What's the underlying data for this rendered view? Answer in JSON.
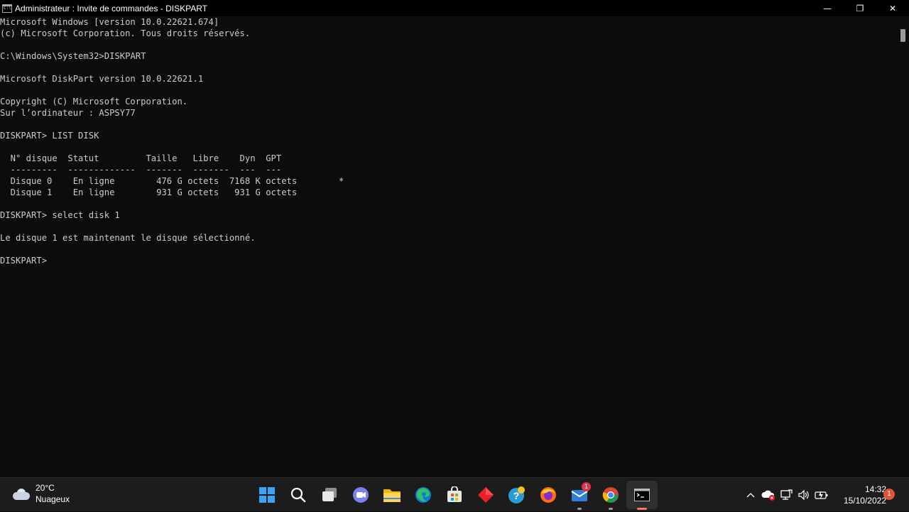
{
  "window": {
    "title": "Administrateur : Invite de commandes - DISKPART",
    "minimize_glyph": "—",
    "maximize_glyph": "❐",
    "close_glyph": "✕"
  },
  "console": {
    "lines": [
      "Microsoft Windows [version 10.0.22621.674]",
      "(c) Microsoft Corporation. Tous droits réservés.",
      "",
      "C:\\Windows\\System32>DISKPART",
      "",
      "Microsoft DiskPart version 10.0.22621.1",
      "",
      "Copyright (C) Microsoft Corporation.",
      "Sur l’ordinateur : ASPSY77",
      "",
      "DISKPART> LIST DISK",
      "",
      "  N° disque  Statut         Taille   Libre    Dyn  GPT",
      "  ---------  -------------  -------  -------  ---  ---",
      "  Disque 0    En ligne        476 G octets  7168 K octets        *",
      "  Disque 1    En ligne        931 G octets   931 G octets",
      "",
      "DISKPART> select disk 1",
      "",
      "Le disque 1 est maintenant le disque sélectionné.",
      "",
      "DISKPART>"
    ]
  },
  "taskbar": {
    "weather": {
      "temp": "20°C",
      "condition": "Nuageux"
    },
    "apps": [
      {
        "name": "start-button",
        "icon": "windows-logo"
      },
      {
        "name": "search-button",
        "icon": "search-icon"
      },
      {
        "name": "task-view-button",
        "icon": "task-view-icon"
      },
      {
        "name": "teams-chat-button",
        "icon": "chat-icon"
      },
      {
        "name": "file-explorer-button",
        "icon": "folder-icon"
      },
      {
        "name": "edge-button",
        "icon": "edge-icon"
      },
      {
        "name": "store-button",
        "icon": "store-icon"
      },
      {
        "name": "app-red-diamond-button",
        "icon": "red-diamond-icon"
      },
      {
        "name": "help-button",
        "icon": "help-icon"
      },
      {
        "name": "firefox-button",
        "icon": "firefox-icon"
      },
      {
        "name": "mail-button",
        "icon": "mail-icon",
        "badge": "1"
      },
      {
        "name": "chrome-button",
        "icon": "chrome-icon"
      },
      {
        "name": "terminal-button",
        "icon": "terminal-icon"
      }
    ],
    "clock": {
      "time": "14:32",
      "date": "15/10/2022"
    },
    "notification_count": "1"
  },
  "colors": {
    "console_bg": "#0c0c0c",
    "console_fg": "#cccccc",
    "taskbar_bg": "#1c1c1c"
  }
}
